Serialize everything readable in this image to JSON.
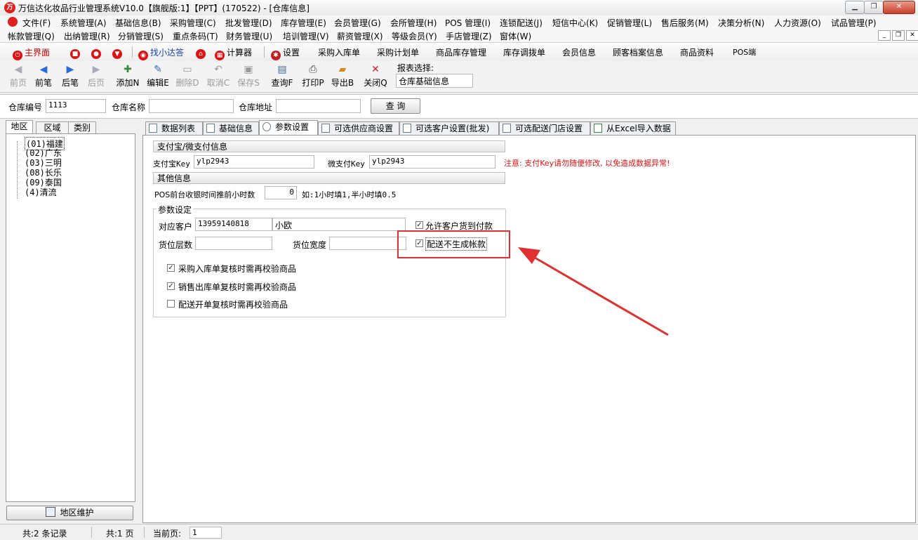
{
  "window": {
    "title": "万信达化妆品行业管理系统V10.0【旗舰版:1】【PPT】(170522) - [仓库信息]",
    "logo_text": "万"
  },
  "menu": {
    "row1": [
      "文件(F)",
      "系统管理(A)",
      "基础信息(B)",
      "采购管理(C)",
      "批发管理(D)",
      "库存管理(E)",
      "会员管理(G)",
      "会所管理(H)",
      "POS 管理(I)",
      "连锁配送(J)",
      "短信中心(K)",
      "促销管理(L)",
      "售后服务(M)",
      "决策分析(N)",
      "人力资源(O)",
      "试品管理(P)"
    ],
    "row2": [
      "帐款管理(Q)",
      "出纳管理(R)",
      "分销管理(S)",
      "重点条码(T)",
      "财务管理(U)",
      "培训管理(V)",
      "薪资管理(X)",
      "等级会员(Y)",
      "手店管理(Z)",
      "窗体(W)"
    ]
  },
  "quickbar": {
    "home": "主界面",
    "find": "找小达答",
    "calculator": "计算器",
    "settings": "设置",
    "links": [
      "采购入库单",
      "采购计划单",
      "商品库存管理",
      "库存调拨单",
      "会员信息",
      "顾客档案信息",
      "商品资料",
      "POS端"
    ]
  },
  "toolbar": {
    "buttons": [
      {
        "label": "前页",
        "icon": "first-page-icon",
        "enabled": false
      },
      {
        "label": "前笔",
        "icon": "prev-record-icon",
        "enabled": true
      },
      {
        "label": "后笔",
        "icon": "next-record-icon",
        "enabled": true
      },
      {
        "label": "后页",
        "icon": "last-page-icon",
        "enabled": false
      },
      {
        "label": "添加N",
        "icon": "add-icon",
        "enabled": true
      },
      {
        "label": "编辑E",
        "icon": "edit-icon",
        "enabled": true
      },
      {
        "label": "删除D",
        "icon": "delete-icon",
        "enabled": false
      },
      {
        "label": "取消C",
        "icon": "undo-icon",
        "enabled": false
      },
      {
        "label": "保存S",
        "icon": "save-icon",
        "enabled": false
      },
      {
        "label": "查询F",
        "icon": "query-icon",
        "enabled": true
      },
      {
        "label": "打印P",
        "icon": "print-icon",
        "enabled": true
      },
      {
        "label": "导出B",
        "icon": "export-icon",
        "enabled": true
      },
      {
        "label": "关闭Q",
        "icon": "close-icon",
        "enabled": true
      }
    ],
    "report_label": "报表选择:",
    "report_value": "仓库基础信息"
  },
  "search": {
    "code_label": "仓库编号",
    "code_value": "1113",
    "name_label": "仓库名称",
    "name_value": "",
    "address_label": "仓库地址",
    "address_value": "",
    "query_button": "查 询"
  },
  "left": {
    "tabs": [
      "地区",
      "区域",
      "类别"
    ],
    "tree": [
      "(01)福建",
      "(02)广东",
      "(03)三明",
      "(08)长乐",
      "(09)泰国",
      "(4)清流"
    ],
    "maintain_button": "地区维护"
  },
  "right": {
    "tabs": [
      "数据列表",
      "基础信息",
      "参数设置",
      "可选供应商设置",
      "可选客户设置(批发)",
      "可选配送门店设置",
      "从Excel导入数据"
    ],
    "pay": {
      "section": "支付宝/微支付信息",
      "alipay_label": "支付宝Key",
      "alipay_value": "ylp2943",
      "wechat_label": "微支付Key",
      "wechat_value": "ylp2943",
      "warning": "注意: 支付Key请勿随便修改, 以免造成数据异常!"
    },
    "other": {
      "section": "其他信息",
      "pos_label": "POS前台收银时间推前小时数",
      "pos_value": "0",
      "pos_hint": "如:1小时填1,半小时填0.5"
    },
    "params": {
      "group": "参数设定",
      "customer_label": "对应客户",
      "customer_code": "13959140818",
      "customer_name": "小欧",
      "allow_cod": "允许客户货到付款",
      "allow_cod_checked": true,
      "no_account": "配送不生成帐款",
      "no_account_checked": true,
      "layers_label": "货位层数",
      "width_label": "货位宽度",
      "check1": "采购入库单复核时需再校验商品",
      "check1_checked": true,
      "check2": "销售出库单复核时需再校验商品",
      "check2_checked": true,
      "check3": "配送开单复核时需再校验商品",
      "check3_checked": false
    }
  },
  "status": {
    "records": "共:2 条记录",
    "pages": "共:1 页",
    "current_label": "当前页:",
    "current_value": "1"
  },
  "colors": {
    "annotation": "#e03030",
    "warning_text": "#e01010"
  }
}
